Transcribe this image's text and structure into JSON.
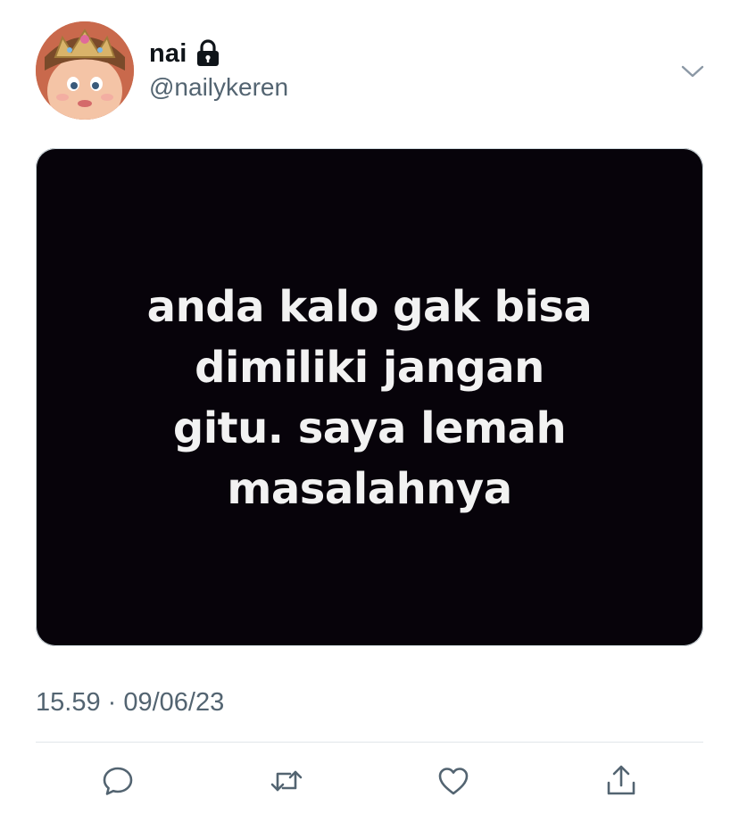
{
  "author": {
    "display_name": "nai",
    "handle": "@nailykeren",
    "avatar_icon": "avatar-princess-icon",
    "protected_icon": "lock-icon"
  },
  "menu_icon": "chevron-down-icon",
  "media": {
    "lines": [
      "anda kalo gak bisa",
      "dimiliki jangan",
      "gitu. saya lemah",
      "masalahnya"
    ]
  },
  "meta": {
    "timestamp": "15.59 · 09/06/23"
  },
  "actions": [
    {
      "icon": "reply-icon"
    },
    {
      "icon": "retweet-icon"
    },
    {
      "icon": "like-icon"
    },
    {
      "icon": "share-icon"
    }
  ],
  "colors": {
    "text_primary": "#0f1419",
    "text_secondary": "#536471",
    "icon": "#536471",
    "media_bg": "#07030a"
  }
}
